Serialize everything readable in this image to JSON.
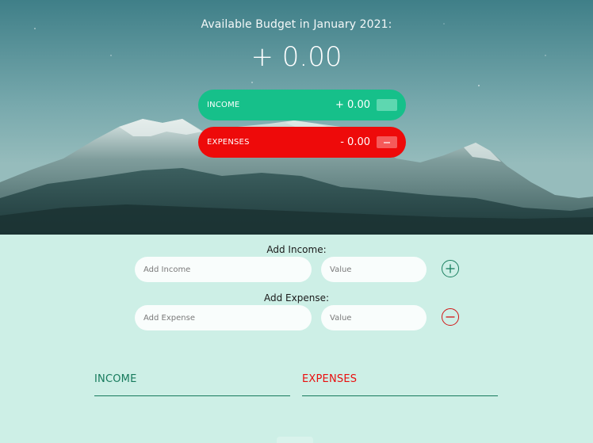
{
  "header": {
    "title": "Available Budget in January 2021:",
    "budget": "+ 0.00"
  },
  "summary": {
    "income": {
      "label": "INCOME",
      "value": "+ 0.00",
      "color": "#16c08a"
    },
    "expenses": {
      "label": "EXPENSES",
      "value": "- 0.00",
      "color": "#ee0a0a"
    }
  },
  "income_form": {
    "label": "Add Income:",
    "description_placeholder": "Add Income",
    "value_placeholder": "Value",
    "button_icon": "plus-circle-icon"
  },
  "expense_form": {
    "label": "Add Expense:",
    "description_placeholder": "Add Expense",
    "value_placeholder": "Value",
    "button_icon": "minus-circle-icon"
  },
  "lists": {
    "income_title": "INCOME",
    "expenses_title": "EXPENSES"
  },
  "colors": {
    "income_green": "#16c08a",
    "income_dark": "#167a5c",
    "expense_red": "#ee0a0a",
    "page_bg": "#cdefe6"
  }
}
